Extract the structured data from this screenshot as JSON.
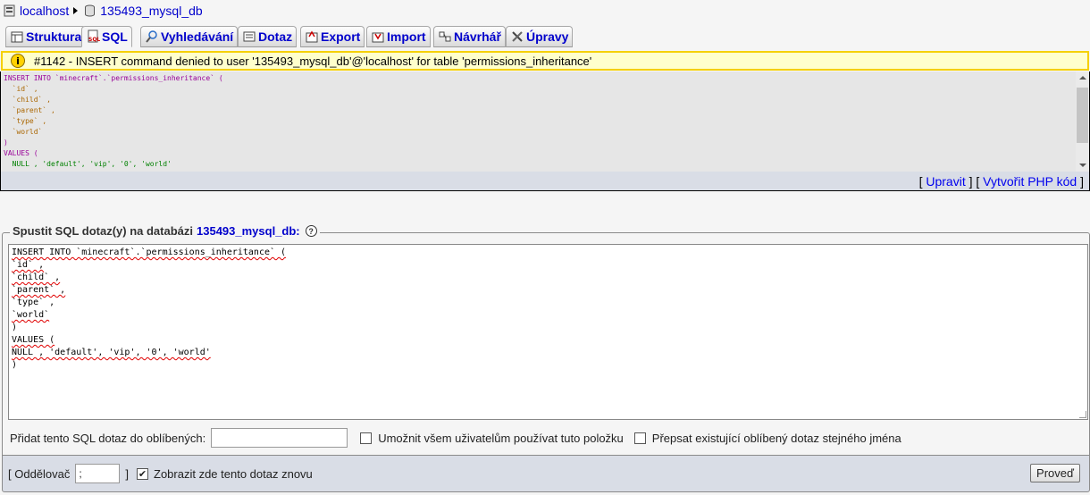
{
  "breadcrumb": {
    "server": "localhost",
    "database": "135493_mysql_db"
  },
  "tabs": [
    {
      "label": "Struktura",
      "icon": "structure-icon"
    },
    {
      "label": "SQL",
      "icon": "sql-icon",
      "active": true
    },
    {
      "label": "Vyhledávání",
      "icon": "search-icon"
    },
    {
      "label": "Dotaz",
      "icon": "query-icon"
    },
    {
      "label": "Export",
      "icon": "export-icon"
    },
    {
      "label": "Import",
      "icon": "import-icon"
    },
    {
      "label": "Návrhář",
      "icon": "designer-icon"
    },
    {
      "label": "Úpravy",
      "icon": "operations-icon"
    }
  ],
  "error": {
    "message": "#1142 - INSERT command denied to user '135493_mysql_db'@'localhost' for table 'permissions_inheritance'"
  },
  "query_links": {
    "open": "[",
    "edit": "Upravit",
    "mid": "] [",
    "php": "Vytvořit PHP kód",
    "close": "]"
  },
  "sql_form": {
    "legend": "Spustit SQL dotaz(y) na databázi",
    "database": "135493_mysql_db:",
    "bookmark_label": "Přidat tento SQL dotaz do oblíbených:",
    "bookmark_value": "",
    "allow_all_label": "Umožnit všem uživatelům používat tuto položku",
    "allow_all_checked": false,
    "replace_label": "Přepsat existující oblíbený dotaz stejného jména",
    "replace_checked": false,
    "delimiter_open": "[ Oddělovač",
    "delimiter_value": ";",
    "delimiter_close": "]",
    "show_again_label": "Zobrazit zde tento dotaz znovu",
    "show_again_checked": true,
    "go_label": "Proveď"
  },
  "query_lines": [
    "INSERT INTO `minecraft`.`permissions_inheritance` (",
    "`id` ,",
    "`child` ,",
    "`parent` ,",
    "`type` ,",
    "`world`",
    ")",
    "VALUES (",
    "NULL , 'default', 'vip', '0', 'world'",
    ")"
  ],
  "colors": {
    "tab_text": "#0000cc",
    "error_bg": "#ffffcc",
    "error_border": "#f5d000",
    "panel_bg": "#d9dde6"
  }
}
